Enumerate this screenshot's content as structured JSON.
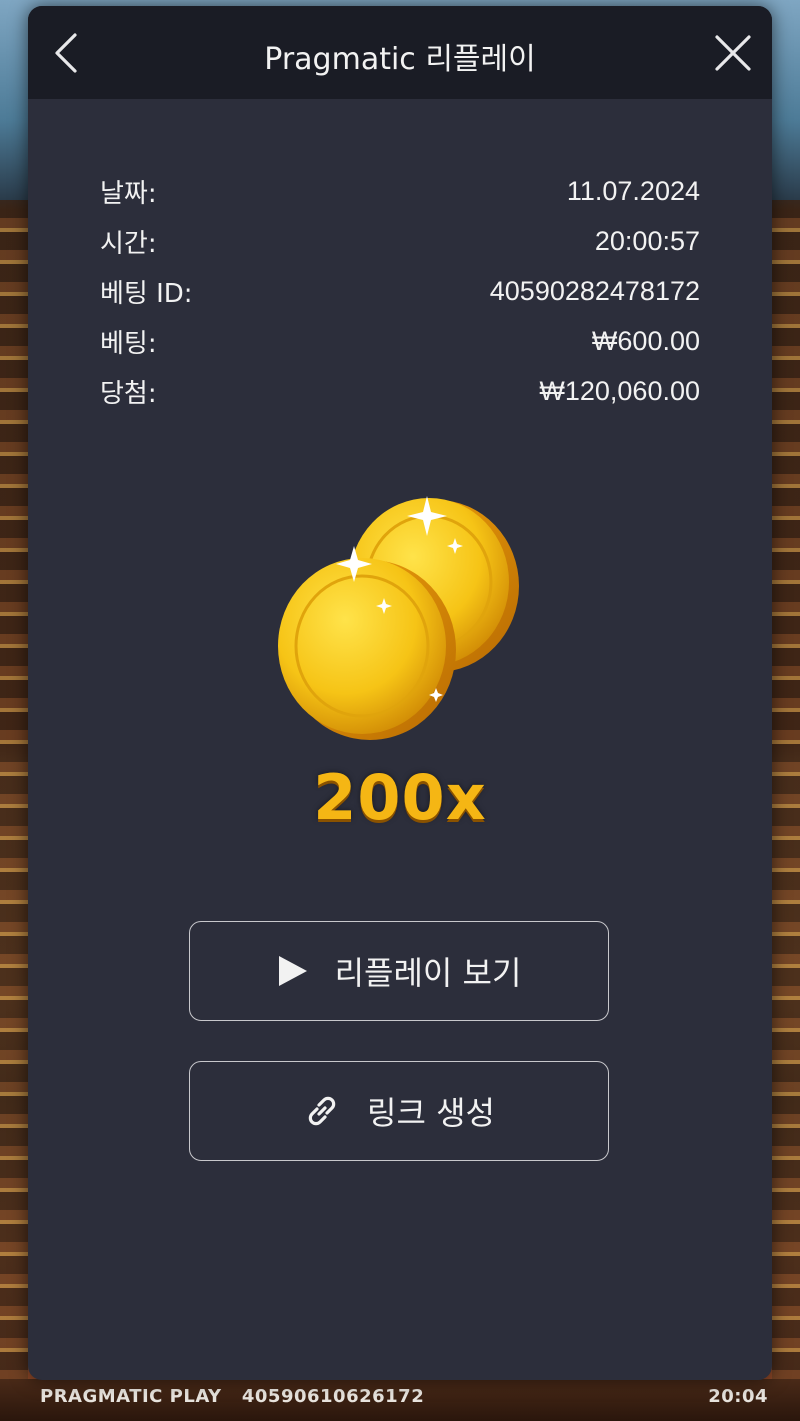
{
  "header": {
    "title": "Pragmatic 리플레이"
  },
  "details": [
    {
      "label": "날짜:",
      "value": "11.07.2024"
    },
    {
      "label": "시간:",
      "value": "20:00:57"
    },
    {
      "label": "베팅 ID:",
      "value": "40590282478172"
    },
    {
      "label": "베팅:",
      "value": "₩600.00"
    },
    {
      "label": "당첨:",
      "value": "₩120,060.00"
    }
  ],
  "win": {
    "multiplier": "200x",
    "icon": "gold-coins-icon"
  },
  "actions": {
    "replay_label": "리플레이 보기",
    "link_label": "링크 생성"
  },
  "background_footer": {
    "brand": "PRAGMATIC PLAY",
    "round_id": "40590610626172",
    "time": "20:04"
  },
  "colors": {
    "modal_bg": "#2c2e3b",
    "header_bg": "#1a1c25",
    "multiplier": "#f5b614"
  }
}
